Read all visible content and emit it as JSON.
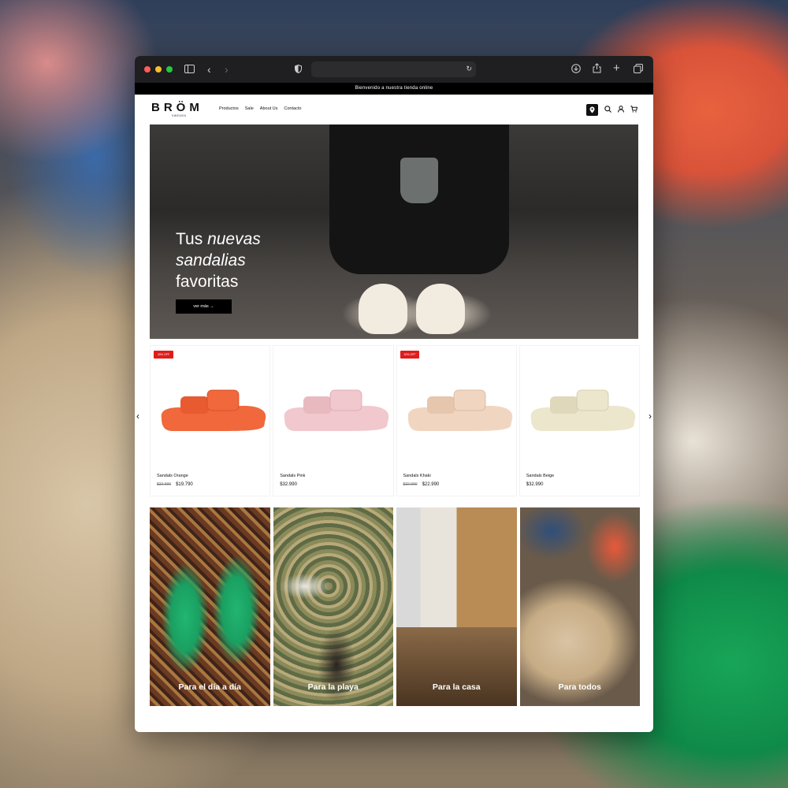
{
  "browser": {
    "url": ""
  },
  "announcement": "Bienvenido a nuestra tienda online",
  "brand": {
    "name": "BRÖM",
    "sub": "SWEDEN"
  },
  "nav": [
    "Productos",
    "Sale",
    "About Us",
    "Contacto"
  ],
  "hero": {
    "line1": "Tus ",
    "line1_em": "nuevas",
    "line2_em": "sandalias",
    "line3": "favoritas",
    "button": "ver más →"
  },
  "products": [
    {
      "name": "Sandals Orange",
      "old_price": "$32.990",
      "price": "$19.790",
      "badge": "40% OFF",
      "color": "#f0683c"
    },
    {
      "name": "Sandals Pink",
      "old_price": "",
      "price": "$32.990",
      "badge": "",
      "color": "#f1c8ce"
    },
    {
      "name": "Sandals Khaki",
      "old_price": "$32.990",
      "price": "$22.990",
      "badge": "30% OFF",
      "color": "#f0d6c1"
    },
    {
      "name": "Sandals Beige",
      "old_price": "",
      "price": "$32.990",
      "badge": "",
      "color": "#ece6cd"
    }
  ],
  "categories": [
    {
      "label": "Para el día a día"
    },
    {
      "label": "Para la playa"
    },
    {
      "label": "Para la casa"
    },
    {
      "label": "Para todos"
    }
  ],
  "colors": {
    "badge": "#e01c1c",
    "chrome": "#1f1f21"
  }
}
